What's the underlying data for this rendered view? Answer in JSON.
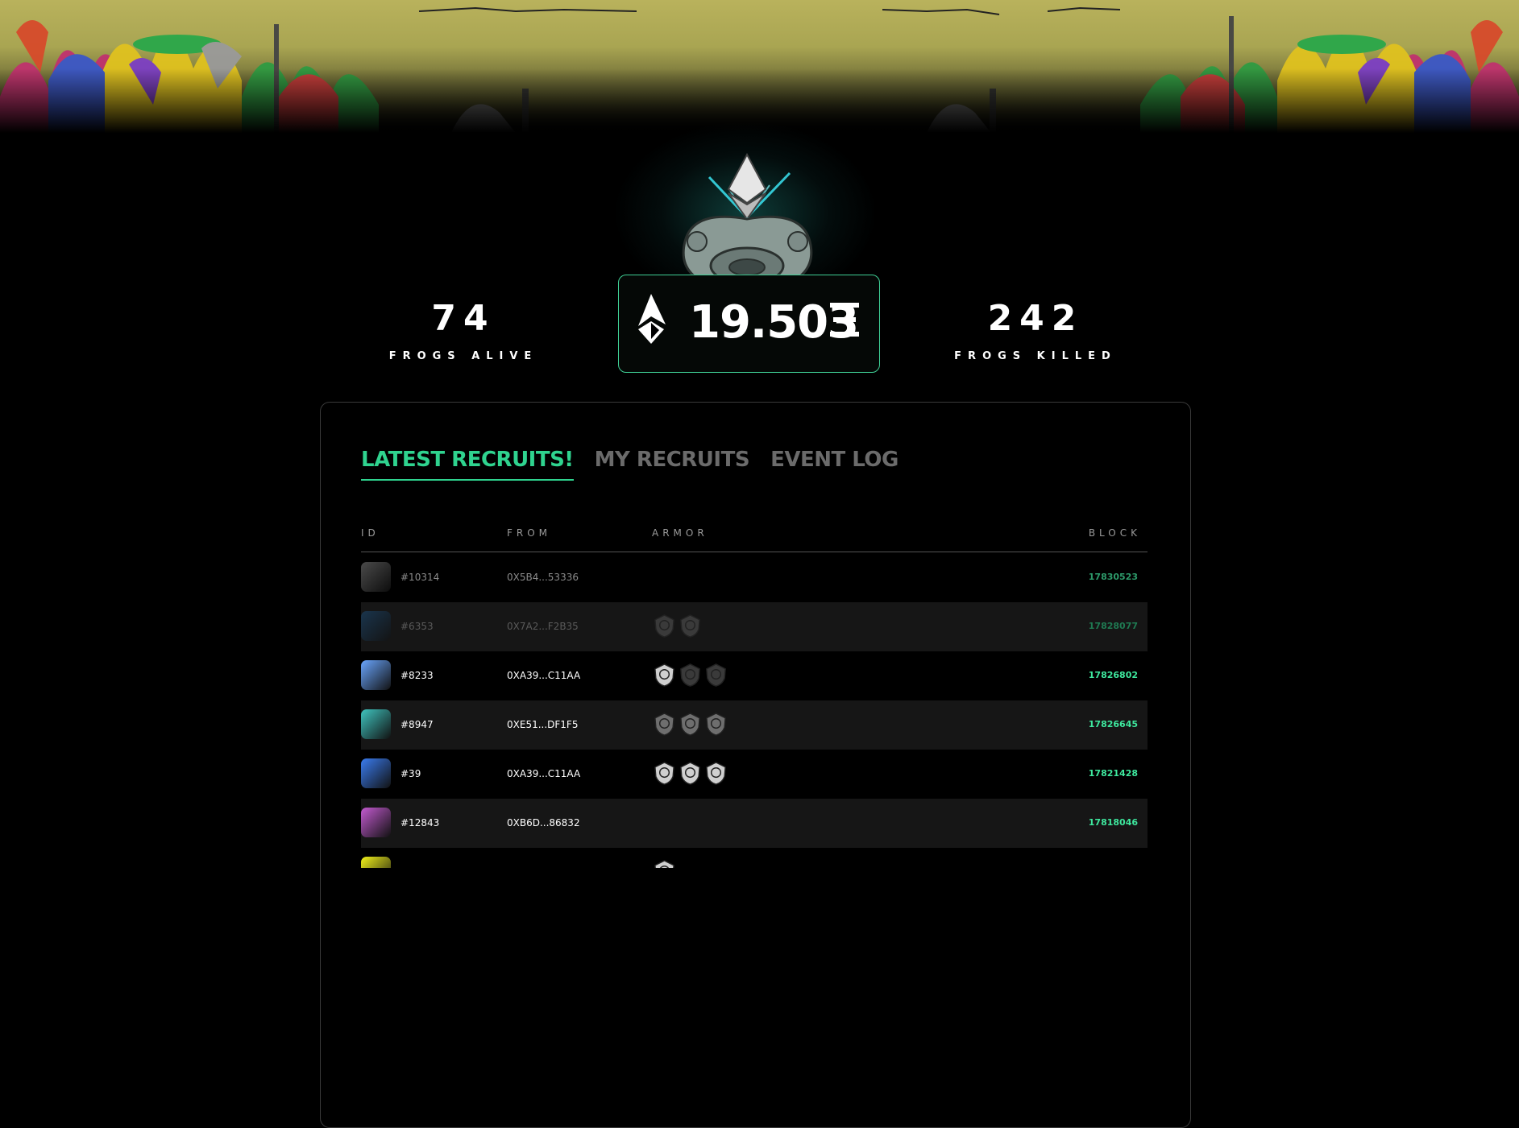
{
  "stats": {
    "alive_value": "74",
    "alive_label": "FROGS ALIVE",
    "killed_value": "242",
    "killed_label": "FROGS KILLED",
    "pot_value": "19.503",
    "pot_symbol": "Ξ"
  },
  "tabs": [
    {
      "label": "LATEST RECRUITS!",
      "active": true
    },
    {
      "label": "MY RECRUITS",
      "active": false
    },
    {
      "label": "EVENT LOG",
      "active": false
    }
  ],
  "table": {
    "headers": {
      "id": "ID",
      "from": "FROM",
      "armor": "ARMOR",
      "block": "BLOCK"
    },
    "rows": [
      {
        "id": "#10314",
        "from": "0X5B4...53336",
        "armor": [],
        "block": "17830523",
        "thumb_color": "#6b6b6b"
      },
      {
        "id": "#6353",
        "from": "0X7A2...F2B35",
        "armor": [
          "dark",
          "dark"
        ],
        "block": "17828077",
        "thumb_color": "#1d4e7a"
      },
      {
        "id": "#8233",
        "from": "0XA39...C11AA",
        "armor": [
          "light",
          "dark",
          "dark"
        ],
        "block": "17826802",
        "thumb_color": "#6aa6ff"
      },
      {
        "id": "#8947",
        "from": "0XE51...DF1F5",
        "armor": [
          "mid",
          "mid",
          "mid"
        ],
        "block": "17826645",
        "thumb_color": "#3fc5c0"
      },
      {
        "id": "#39",
        "from": "0XA39...C11AA",
        "armor": [
          "light",
          "light",
          "light"
        ],
        "block": "17821428",
        "thumb_color": "#3a7cf0"
      },
      {
        "id": "#12843",
        "from": "0XB6D...86832",
        "armor": [],
        "block": "17818046",
        "thumb_color": "#c45bd1"
      },
      {
        "id": "",
        "from": "",
        "armor": [
          "light"
        ],
        "block": "",
        "thumb_color": "#f2f21a"
      }
    ]
  },
  "colors": {
    "accent": "#2fd38f",
    "block": "#3ee89e",
    "border": "#3fcf95"
  },
  "icons": [
    "ethereum-logo-icon",
    "eth-symbol-icon",
    "stone-altar-icon",
    "shield-armor-icon"
  ]
}
